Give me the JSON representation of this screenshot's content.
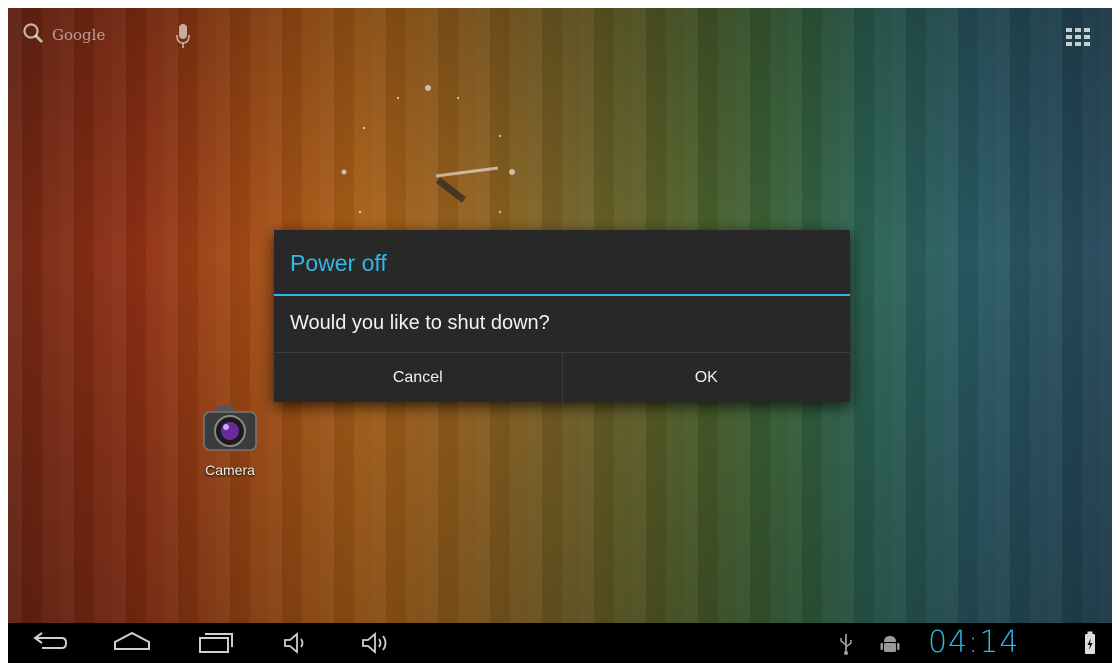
{
  "search": {
    "label": "Google"
  },
  "dialog": {
    "title": "Power off",
    "message": "Would you like to shut down?",
    "cancel_label": "Cancel",
    "ok_label": "OK"
  },
  "desktop": {
    "camera_label": "Camera"
  },
  "status_bar": {
    "time": "04:14"
  },
  "colors": {
    "accent": "#33b5e5",
    "dialog_bg": "#282828"
  }
}
